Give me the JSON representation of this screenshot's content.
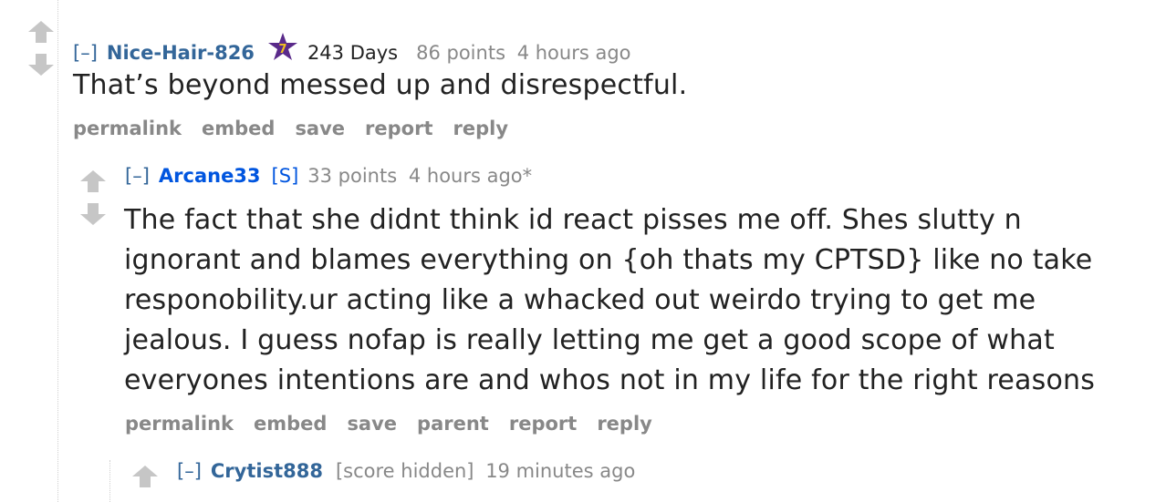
{
  "comments": [
    {
      "expand": "[–]",
      "author": "Nice-Hair-826",
      "flair_days": "243 Days",
      "flair_badge": "7",
      "score": "86 points",
      "time": "4 hours ago",
      "body": "That’s beyond messed up and disrespectful.",
      "buttons": [
        "permalink",
        "embed",
        "save",
        "report",
        "reply"
      ]
    },
    {
      "expand": "[–]",
      "author": "Arcane33",
      "submitter_tag": "[S]",
      "score": "33 points",
      "time": "4 hours ago*",
      "body_lines": [
        "The fact that she didnt think id react pisses me off. Shes slutty n",
        "ignorant and blames everything on {oh thats my CPTSD} like no take",
        "responobility.ur acting like a whacked out weirdo trying to get me",
        "jealous. I guess nofap is really letting me get a good scope of what",
        "everyones intentions are and whos not in my life for the right reasons"
      ],
      "buttons": [
        "permalink",
        "embed",
        "save",
        "parent",
        "report",
        "reply"
      ]
    },
    {
      "expand": "[–]",
      "author": "Crytist888",
      "score": "[score hidden]",
      "time": "19 minutes ago"
    }
  ],
  "colors": {
    "link": "#336699",
    "op": "#0055df",
    "meta": "#888888",
    "arrow": "#c6c6c6",
    "star": "#5a2a8a",
    "star_text": "#f0c020"
  },
  "icons": {
    "upvote": "arrow-up-icon",
    "downvote": "arrow-down-icon",
    "flair": "star-badge-icon"
  }
}
